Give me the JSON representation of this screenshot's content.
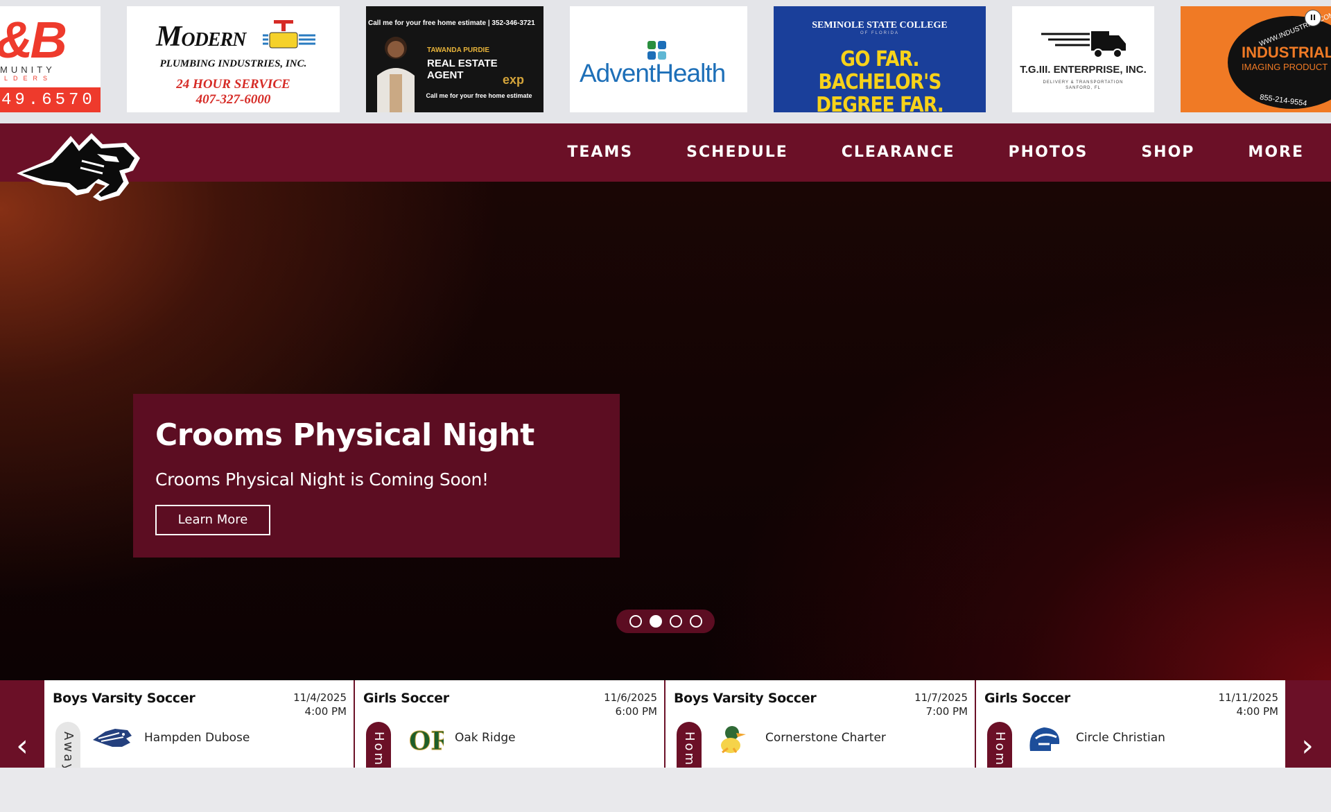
{
  "sponsors": {
    "cb": {
      "logo": "&B",
      "line1": "MUNITY",
      "line2": "LDERS",
      "phone": "49.6570"
    },
    "modern": {
      "name_big": "M",
      "name_rest": "ODERN",
      "sub": "PLUMBING INDUSTRIES, INC.",
      "service": "24 HOUR SERVICE",
      "phone": "407-327-6000"
    },
    "agent": {
      "top": "Call me for your free home estimate | 352-346-3721",
      "person_name": "TAWANDA PURDIE",
      "role": "REAL ESTATE AGENT",
      "brand": "exp",
      "bottom": "Call me for your free home estimate"
    },
    "advent": {
      "name": "AdventHealth"
    },
    "ssc": {
      "college": "SEMINOLE STATE COLLEGE",
      "college_sub": "OF FLORIDA",
      "slogan_a": "GO FAR.",
      "slogan_b": "BACHELOR'S",
      "slogan_c": "DEGREE FAR."
    },
    "tg": {
      "name": "T.G.III. ENTERPRISE, INC.",
      "sub1": "DELIVERY & TRANSPORTATION",
      "sub2": "SANFORD, FL"
    },
    "industrial": {
      "name": "INDUSTRIAL",
      "sub": "IMAGING PRODUCT",
      "url": "WWW.INDUSTRIAL.COM",
      "phone": "855-214-9554"
    },
    "pause_label": "II"
  },
  "nav": {
    "items": [
      "TEAMS",
      "SCHEDULE",
      "CLEARANCE",
      "PHOTOS",
      "SHOP",
      "MORE"
    ]
  },
  "hero": {
    "title": "Crooms Physical Night",
    "subtitle": "Crooms Physical Night is Coming Soon!",
    "button": "Learn More",
    "slide_count": 4,
    "active_slide": 2
  },
  "schedule": {
    "prev_label": "‹",
    "next_label": "›",
    "games": [
      {
        "sport": "Boys Varsity Soccer",
        "date": "11/4/2025",
        "time": "4:00 PM",
        "location": "Away",
        "opponent": "Hampden Dubose",
        "logo": "cougar-logo"
      },
      {
        "sport": "Girls Soccer",
        "date": "11/6/2025",
        "time": "6:00 PM",
        "location": "Home",
        "opponent": "Oak Ridge",
        "logo": "or-monogram-logo"
      },
      {
        "sport": "Boys Varsity Soccer",
        "date": "11/7/2025",
        "time": "7:00 PM",
        "location": "Home",
        "opponent": "Cornerstone Charter",
        "logo": "duck-mascot-logo"
      },
      {
        "sport": "Girls Soccer",
        "date": "11/11/2025",
        "time": "4:00 PM",
        "location": "Home",
        "opponent": "Circle Christian",
        "logo": "spartan-helmet-logo"
      }
    ]
  },
  "colors": {
    "maroon": "#6b1027",
    "card": "#5c0d22",
    "accent_red": "#ee3a2c",
    "ssc_blue": "#1a3f9a",
    "ind_orange": "#f07a25"
  }
}
